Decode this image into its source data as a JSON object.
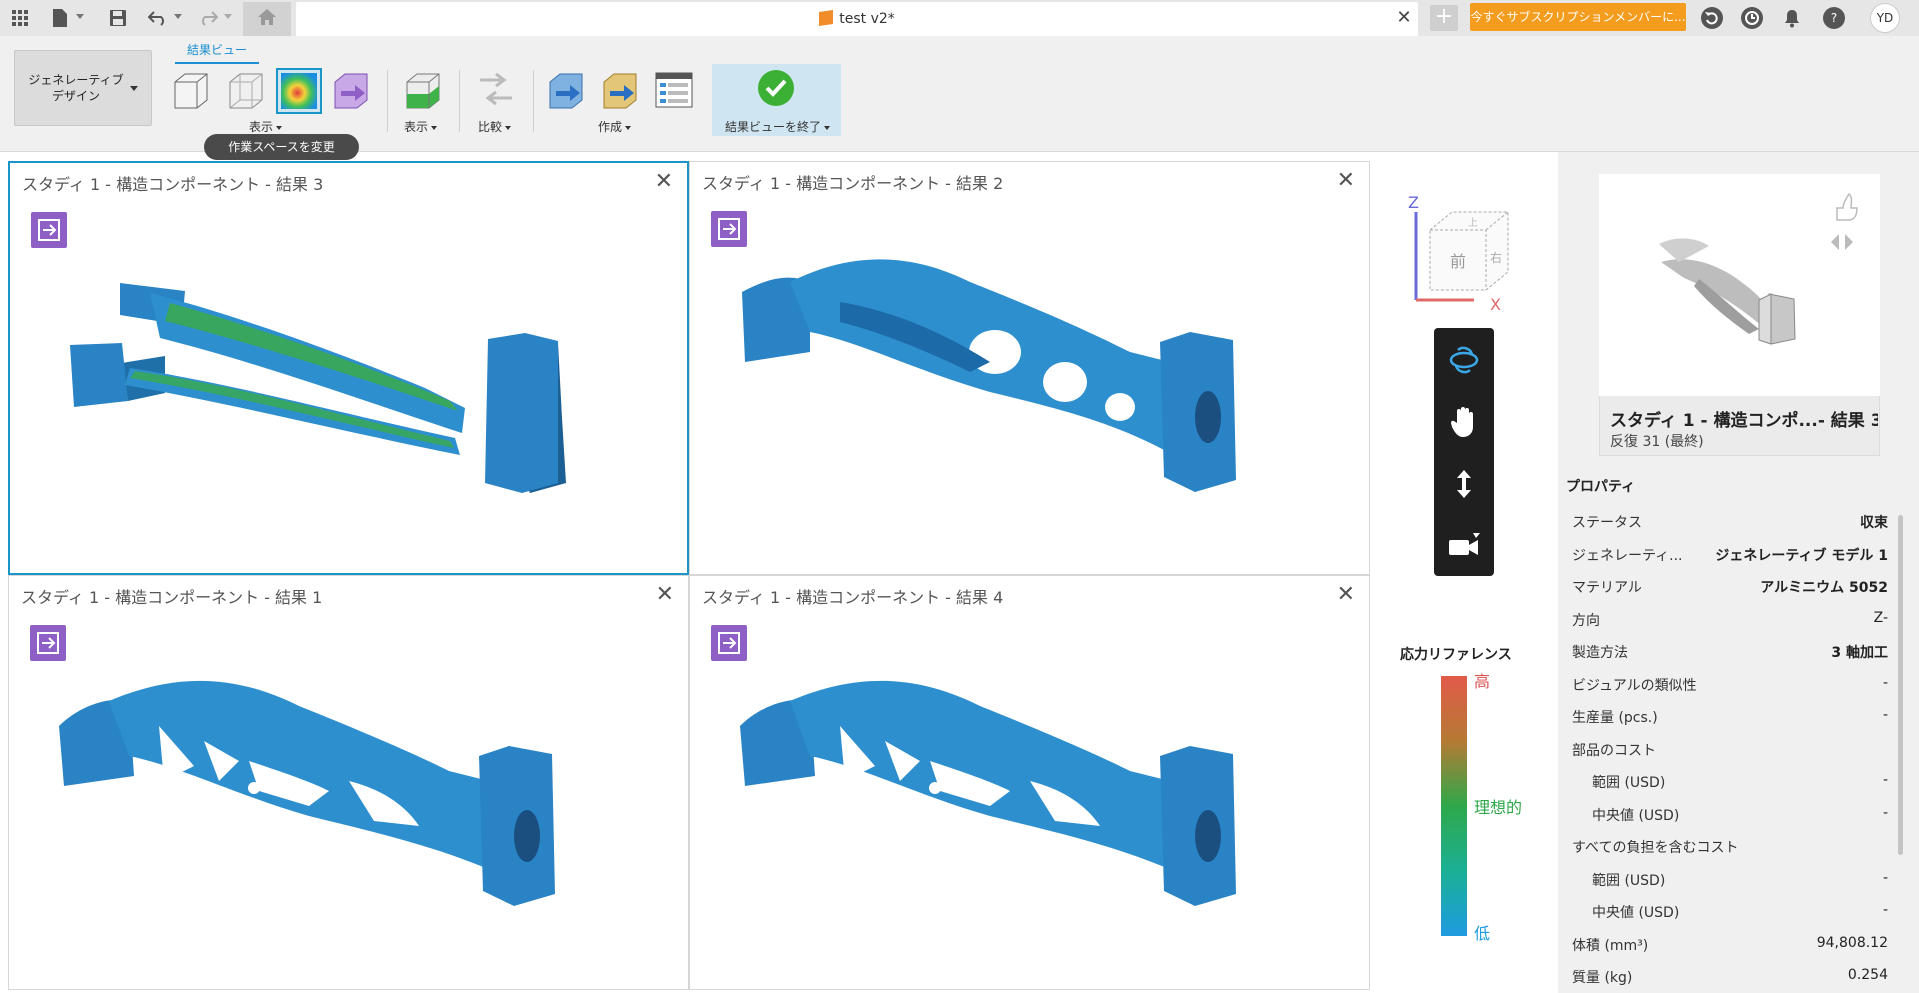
{
  "topbar": {
    "doc_title": "test v2*",
    "close_glyph": "✕",
    "new_tab_glyph": "+",
    "subscribe_label": "今すぐサブスクリプションメンバーに...",
    "help_glyph": "?",
    "avatar_initials": "YD",
    "icons": [
      "grid-icon",
      "file-icon",
      "save-icon",
      "undo-icon",
      "redo-icon",
      "home-icon",
      "refresh-icon",
      "clock-icon",
      "bell-icon",
      "help-icon"
    ]
  },
  "ribbon": {
    "workspace_label_1": "ジェネレーティブ",
    "workspace_label_2": "デザイン",
    "tab_label": "結果ビュー",
    "groups": {
      "display1": "表示",
      "display2": "表示",
      "compare": "比較",
      "create": "作成",
      "finish": "結果ビューを終了"
    },
    "tooltip": "作業スペースを変更"
  },
  "viewports": [
    {
      "title": "スタディ 1 - 構造コンポーネント - 結果 3",
      "close": "✕",
      "active": true
    },
    {
      "title": "スタディ 1 - 構造コンポーネント - 結果 2",
      "close": "✕",
      "active": false
    },
    {
      "title": "スタディ 1 - 構造コンポーネント - 結果 1",
      "close": "✕",
      "active": false
    },
    {
      "title": "スタディ 1 - 構造コンポーネント - 結果 4",
      "close": "✕",
      "active": false
    }
  ],
  "viewcube": {
    "z": "Z",
    "x": "X",
    "front": "前",
    "right": "右",
    "top": "上"
  },
  "nav_icons": [
    "orbit-icon",
    "pan-icon",
    "zoom-icon",
    "camera-icon"
  ],
  "stress": {
    "title": "応力リファレンス",
    "high": "高",
    "mid": "理想的",
    "low": "低",
    "colors": {
      "high": "#e25a4a",
      "mid": "#2ea84a",
      "low": "#1e9be0"
    }
  },
  "result_card": {
    "title": "スタディ 1 - 構造コンポ...- 結果 3",
    "subtitle": "反復 31 (最終)"
  },
  "properties": {
    "heading": "プロパティ",
    "rows": [
      {
        "key": "ステータス",
        "value": "収束"
      },
      {
        "key": "ジェネレーティ...",
        "value": "ジェネレーティブ モデル 1"
      },
      {
        "key": "マテリアル",
        "value": "アルミニウム 5052"
      },
      {
        "key": "方向",
        "value": "Z-"
      },
      {
        "key": "製造方法",
        "value": "3 軸加工"
      },
      {
        "key": "ビジュアルの類似性",
        "value": "-"
      },
      {
        "key": "生産量 (pcs.)",
        "value": "-"
      },
      {
        "key": "部品のコスト",
        "value": ""
      },
      {
        "key": "範囲 (USD)",
        "value": "-"
      },
      {
        "key": "中央値 (USD)",
        "value": "-"
      },
      {
        "key": "すべての負担を含むコスト",
        "value": ""
      },
      {
        "key": "範囲 (USD)",
        "value": "-"
      },
      {
        "key": "中央値 (USD)",
        "value": "-"
      },
      {
        "key": "体積 (mm³)",
        "value": "94,808.12"
      },
      {
        "key": "質量 (kg)",
        "value": "0.254"
      }
    ]
  }
}
